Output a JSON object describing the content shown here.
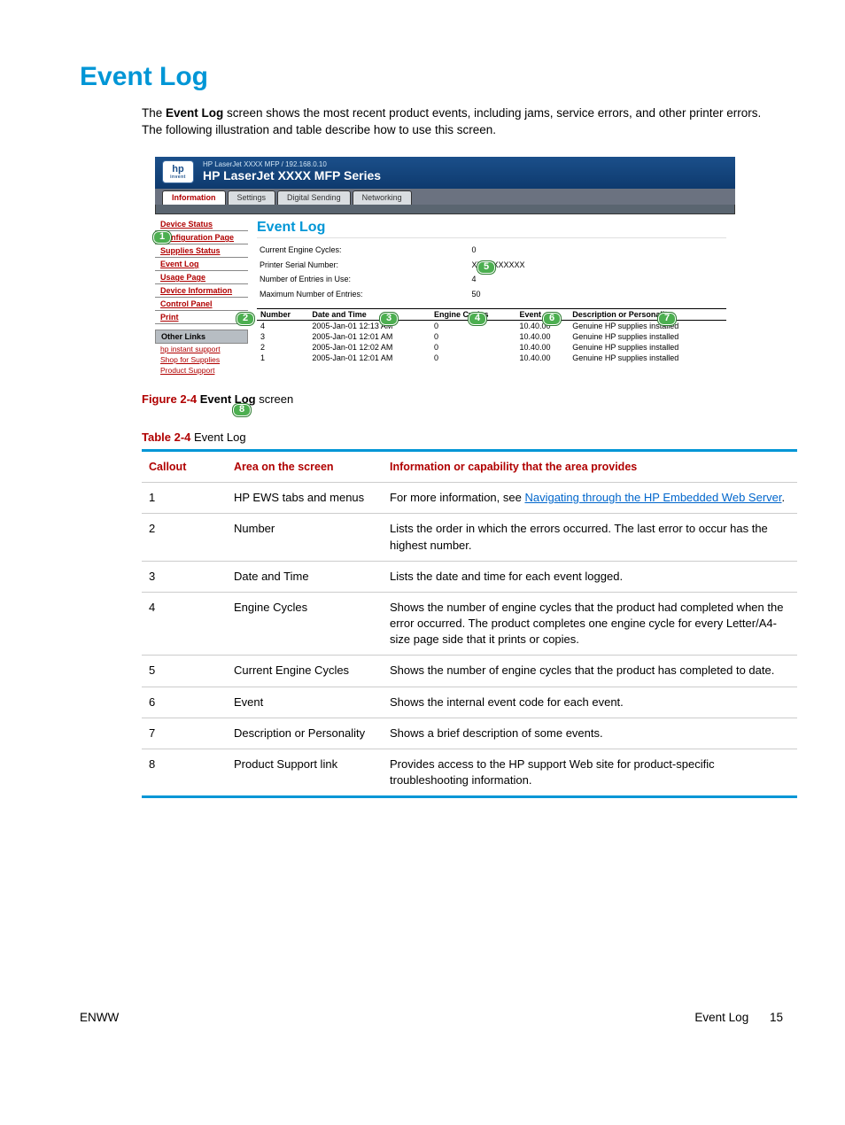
{
  "heading": "Event Log",
  "intro_pre": "The ",
  "intro_bold": "Event Log",
  "intro_post": " screen shows the most recent product events, including jams, service errors, and other printer errors. The following illustration and table describe how to use this screen.",
  "ews": {
    "logo_text": "hp",
    "logo_sub": "invent",
    "breadcrumb": "HP LaserJet XXXX MFP / 192.168.0.10",
    "product": "HP LaserJet XXXX MFP Series",
    "tabs": [
      "Information",
      "Settings",
      "Digital Sending",
      "Networking"
    ],
    "side_items": [
      "Device Status",
      "Configuration Page",
      "Supplies Status",
      "Event Log",
      "Usage Page",
      "Device Information",
      "Control Panel",
      "Print"
    ],
    "other_links_head": "Other Links",
    "other_links": [
      "hp instant support",
      "Shop for Supplies",
      "Product Support"
    ],
    "page_title": "Event Log",
    "stats": {
      "cec_label": "Current Engine Cycles:",
      "cec_value": "0",
      "psn_label": "Printer Serial Number:",
      "psn_value": "XXXXXXXXXX",
      "neu_label": "Number of Entries in Use:",
      "neu_value": "4",
      "mne_label": "Maximum Number of Entries:",
      "mne_value": "50"
    },
    "cols": [
      "Number",
      "Date and Time",
      "Engine Cycles",
      "Event",
      "Description or Personality"
    ],
    "rows": [
      {
        "n": "4",
        "dt": "2005-Jan-01 12:13 AM",
        "ec": "0",
        "ev": "10.40.00",
        "d": "Genuine HP supplies installed"
      },
      {
        "n": "3",
        "dt": "2005-Jan-01 12:01 AM",
        "ec": "0",
        "ev": "10.40.00",
        "d": "Genuine HP supplies installed"
      },
      {
        "n": "2",
        "dt": "2005-Jan-01 12:02 AM",
        "ec": "0",
        "ev": "10.40.00",
        "d": "Genuine HP supplies installed"
      },
      {
        "n": "1",
        "dt": "2005-Jan-01 12:01 AM",
        "ec": "0",
        "ev": "10.40.00",
        "d": "Genuine HP supplies installed"
      }
    ]
  },
  "callout_bubbles": [
    "1",
    "2",
    "3",
    "4",
    "5",
    "6",
    "7",
    "8"
  ],
  "figure": {
    "num": "Figure 2-4",
    "sep": "  ",
    "bold": "Event Log",
    "rest": " screen"
  },
  "table_caption": {
    "num": "Table 2-4",
    "rest": "  Event Log"
  },
  "table_headers": {
    "c": "Callout",
    "a": "Area on the screen",
    "i": "Information or capability that the area provides"
  },
  "table_rows": [
    {
      "c": "1",
      "a": "HP EWS tabs and menus",
      "pre": "For more information, see ",
      "link": "Navigating through the HP Embedded Web Server",
      "post": "."
    },
    {
      "c": "2",
      "a": "Number",
      "i": "Lists the order in which the errors occurred. The last error to occur has the highest number."
    },
    {
      "c": "3",
      "a": "Date and Time",
      "i": "Lists the date and time for each event logged."
    },
    {
      "c": "4",
      "a": "Engine Cycles",
      "i": "Shows the number of engine cycles that the product had completed when the error occurred. The product completes one engine cycle for every Letter/A4-size page side that it prints or copies."
    },
    {
      "c": "5",
      "a": "Current Engine Cycles",
      "i": "Shows the number of engine cycles that the product has completed to date."
    },
    {
      "c": "6",
      "a": "Event",
      "i": "Shows the internal event code for each event."
    },
    {
      "c": "7",
      "a": "Description or Personality",
      "i": "Shows a brief description of some events."
    },
    {
      "c": "8",
      "a": "Product Support link",
      "i": "Provides access to the HP support Web site for product-specific troubleshooting information."
    }
  ],
  "footer": {
    "left": "ENWW",
    "right_label": "Event Log",
    "page": "15"
  }
}
